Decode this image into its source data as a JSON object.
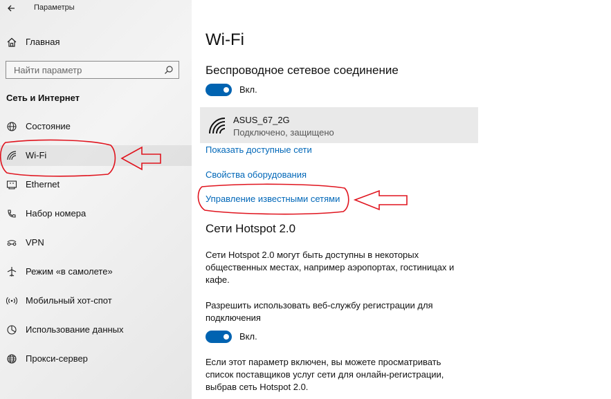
{
  "window": {
    "title": "Параметры"
  },
  "sidebar": {
    "home_label": "Главная",
    "search_placeholder": "Найти параметр",
    "section_title": "Сеть и Интернет",
    "items": [
      {
        "label": "Состояние",
        "icon": "globe-icon"
      },
      {
        "label": "Wi-Fi",
        "icon": "wifi-icon",
        "selected": true
      },
      {
        "label": "Ethernet",
        "icon": "ethernet-icon"
      },
      {
        "label": "Набор номера",
        "icon": "dialup-icon"
      },
      {
        "label": "VPN",
        "icon": "vpn-icon"
      },
      {
        "label": "Режим «в самолете»",
        "icon": "airplane-icon"
      },
      {
        "label": "Мобильный хот-спот",
        "icon": "hotspot-icon"
      },
      {
        "label": "Использование данных",
        "icon": "data-usage-icon"
      },
      {
        "label": "Прокси-сервер",
        "icon": "proxy-globe-icon"
      }
    ]
  },
  "main": {
    "title": "Wi-Fi",
    "wireless_heading": "Беспроводное сетевое соединение",
    "wireless_toggle": {
      "state": "Вкл.",
      "on": true
    },
    "network": {
      "name": "ASUS_67_2G",
      "status": "Подключено, защищено"
    },
    "links": {
      "show_networks": "Показать доступные сети",
      "hardware_props": "Свойства оборудования",
      "manage_known": "Управление известными сетями"
    },
    "hotspot_heading": "Сети Hotspot 2.0",
    "hotspot_desc": "Сети Hotspot 2.0 могут быть доступны в некоторых общественных местах, например аэропортах, гостиницах и кафе.",
    "registration_label": "Разрешить использовать веб-службу регистрации для подключения",
    "registration_toggle": {
      "state": "Вкл.",
      "on": true
    },
    "registration_desc": "Если этот параметр включен, вы можете просматривать список поставщиков услуг сети для онлайн-регистрации, выбрав сеть Hotspot 2.0."
  },
  "colors": {
    "accent": "#0063b1",
    "link": "#0067b8",
    "annotation": "#e0141e"
  }
}
